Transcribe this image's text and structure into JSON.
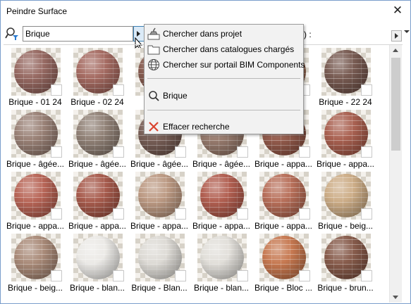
{
  "window": {
    "title": "Peindre Surface",
    "close_glyph": "✕"
  },
  "search": {
    "value": "Brique"
  },
  "header_hint": "s) :",
  "menu": {
    "items": [
      {
        "label": "Chercher dans projet",
        "icon": "project-search-icon"
      },
      {
        "label": "Chercher dans catalogues chargés",
        "icon": "folder-icon"
      },
      {
        "label": "Chercher sur portail BIM Components",
        "icon": "globe-icon"
      },
      {
        "label": "Brique",
        "icon": "search-icon"
      },
      {
        "label": "Effacer recherche",
        "icon": "clear-x-icon"
      }
    ]
  },
  "materials": [
    {
      "label": "Brique - 01 24",
      "color": "#8c5a52"
    },
    {
      "label": "Brique - 02 24",
      "color": "#9c5c52"
    },
    {
      "label": "",
      "color": "#7a4b3e"
    },
    {
      "label": "",
      "color": "#8c6a55"
    },
    {
      "label": "",
      "color": "#a06a50"
    },
    {
      "label": "Brique - 22 24",
      "color": "#6a4a40"
    },
    {
      "label": "Brique - âgée...",
      "color": "#8f7468"
    },
    {
      "label": "Brique - âgée...",
      "color": "#857468"
    },
    {
      "label": "Brique - âgée...",
      "color": "#6a4e45"
    },
    {
      "label": "Brique - âgée...",
      "color": "#8f6f60"
    },
    {
      "label": "Brique - appa...",
      "color": "#8a4b3a"
    },
    {
      "label": "Brique - appa...",
      "color": "#a0503e"
    },
    {
      "label": "Brique - appa...",
      "color": "#b05545"
    },
    {
      "label": "Brique - appa...",
      "color": "#9e4a3a"
    },
    {
      "label": "Brique - appa...",
      "color": "#b58f76"
    },
    {
      "label": "Brique - appa...",
      "color": "#a94e3e"
    },
    {
      "label": "Brique - appa...",
      "color": "#b06048"
    },
    {
      "label": "Brique - beig...",
      "color": "#c7a47a"
    },
    {
      "label": "Brique - beig...",
      "color": "#a07e6a"
    },
    {
      "label": "Brique - blan...",
      "color": "#e9e7e3"
    },
    {
      "label": "Brique - Blan...",
      "color": "#d9d6d0"
    },
    {
      "label": "Brique - blan...",
      "color": "#dedbd5"
    },
    {
      "label": "Brique - Bloc ...",
      "color": "#c06a3e"
    },
    {
      "label": "Brique - brun...",
      "color": "#7a4a38"
    }
  ]
}
